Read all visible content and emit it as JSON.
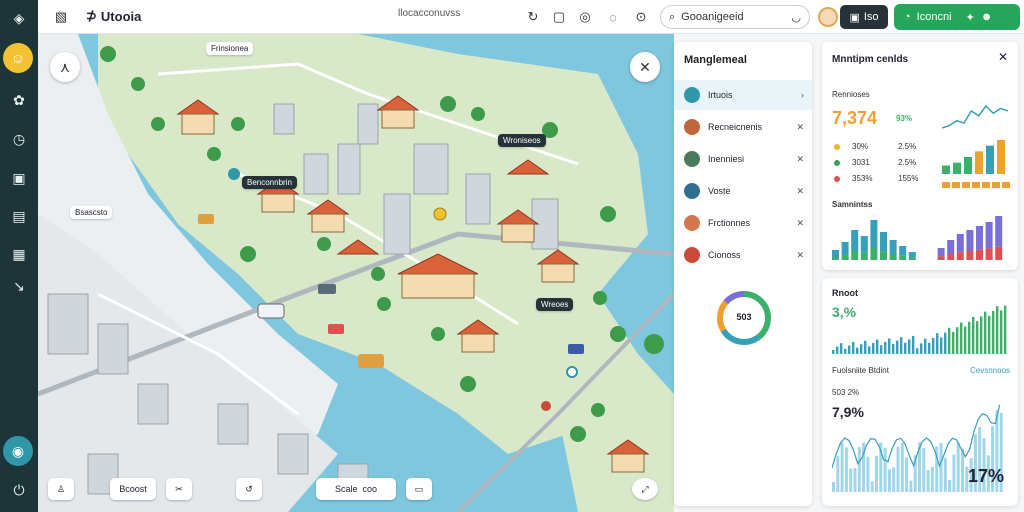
{
  "app": {
    "title": "Utooia",
    "center_label": "llocacconuvss"
  },
  "topbar": {
    "search_value": "Gooanigeeid",
    "dark_button_label": "Iso",
    "green_button_label": "Iconcni"
  },
  "map": {
    "labels": [
      "Frinsionea",
      "Wroniseos",
      "Bsascsto",
      "Benconnbrin",
      "Wreoes"
    ],
    "toolbar": [
      "Bcoost",
      "coo"
    ]
  },
  "management": {
    "title": "Manglemeal",
    "items": [
      {
        "label": "Irtuois",
        "color": "#2f97a8"
      },
      {
        "label": "Recneicnenis",
        "color": "#c0663b"
      },
      {
        "label": "Inenniesi",
        "color": "#4a7a5a"
      },
      {
        "label": "Voste",
        "color": "#2f6f8f"
      },
      {
        "label": "Frctionnes",
        "color": "#d0784e"
      },
      {
        "label": "Cionoss",
        "color": "#c94b3a"
      }
    ],
    "donut_value": "503"
  },
  "card1": {
    "title": "Mnntipm cenlds",
    "section_label": "Rennioses",
    "big_number": "7,374",
    "percent": "93%",
    "rows": [
      {
        "a": "30%",
        "b": "2.5%",
        "color": "#f0b429"
      },
      {
        "a": "3031",
        "b": "2.5%",
        "color": "#2fa35a"
      },
      {
        "a": "353%",
        "b": "155%",
        "color": "#d9534f"
      }
    ],
    "subtitle": "Samnintss",
    "colors": {
      "teal": "#35a0b8",
      "green": "#3cb06a",
      "orange": "#f0a030",
      "purple": "#7a6fd8",
      "red": "#e05050"
    }
  },
  "card2": {
    "title": "Rnoot",
    "big_number": "3,%",
    "sub_label": "Fuolsniite Btdint",
    "sub_link": "Cevsnnoos",
    "sub_number": "503 2%",
    "big_number2": "7,9%",
    "big_number3": "17%"
  },
  "chart_data": [
    {
      "type": "line",
      "title": "",
      "series": [
        {
          "values": [
            5,
            6,
            8,
            7,
            12,
            10,
            14,
            11,
            13,
            12
          ]
        }
      ]
    },
    {
      "type": "bar",
      "title": "",
      "series": [
        {
          "values": [
            3,
            4,
            6,
            8,
            10,
            12
          ]
        }
      ]
    }
  ]
}
